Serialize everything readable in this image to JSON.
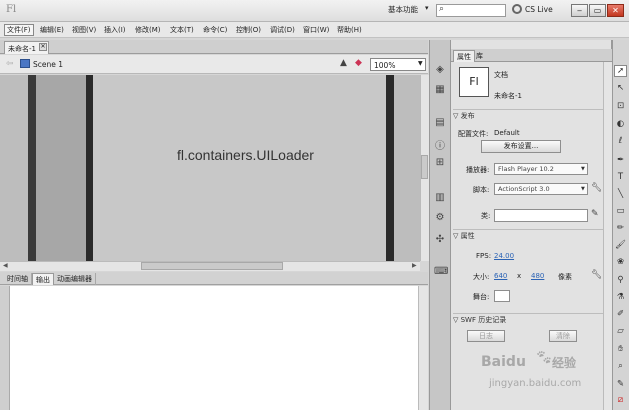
{
  "titlebar": {
    "logo": "Fl",
    "workspace": "基本功能",
    "cslive": "CS Live",
    "winbtns": [
      "‒",
      "▭",
      "✕"
    ]
  },
  "menu": [
    "文件(F)",
    "编辑(E)",
    "视图(V)",
    "插入(I)",
    "修改(M)",
    "文本(T)",
    "命令(C)",
    "控制(O)",
    "调试(D)",
    "窗口(W)",
    "帮助(H)"
  ],
  "document": {
    "tab_label": "未命名-1",
    "scene_label": "Scene 1",
    "zoom": "100%",
    "stage_text": "fl.containers.UILoader"
  },
  "bottom_tabs": [
    "时间轴",
    "输出",
    "动画编辑器"
  ],
  "properties": {
    "tabs": [
      "属性",
      "库"
    ],
    "fl_icon": "Fl",
    "doc_type": "文档",
    "doc_name": "未命名-1",
    "publish": {
      "header": "发布",
      "profile_label": "配置文件:",
      "profile_value": "Default",
      "settings_button": "发布设置...",
      "player_label": "播放器:",
      "player_value": "Flash Player 10.2",
      "script_label": "脚本:",
      "script_value": "ActionScript 3.0",
      "class_label": "类:"
    },
    "props": {
      "header": "属性",
      "fps_label": "FPS:",
      "fps_value": "24.00",
      "size_label": "大小:",
      "width": "640",
      "x": "x",
      "height": "480",
      "unit": "像素",
      "stage_label": "舞台:"
    },
    "swf": {
      "header": "SWF 历史记录",
      "log_button": "日志",
      "clear_button": "清除"
    }
  },
  "watermark": {
    "brand": "Baidu",
    "brand_cn": "经验",
    "url": "jingyan.baidu.com"
  },
  "colors": {
    "stage_bg": "#c8c8c8",
    "stage_bar": "#3a3a3a",
    "link": "#2b63b5",
    "close_btn": "#c2371f"
  }
}
